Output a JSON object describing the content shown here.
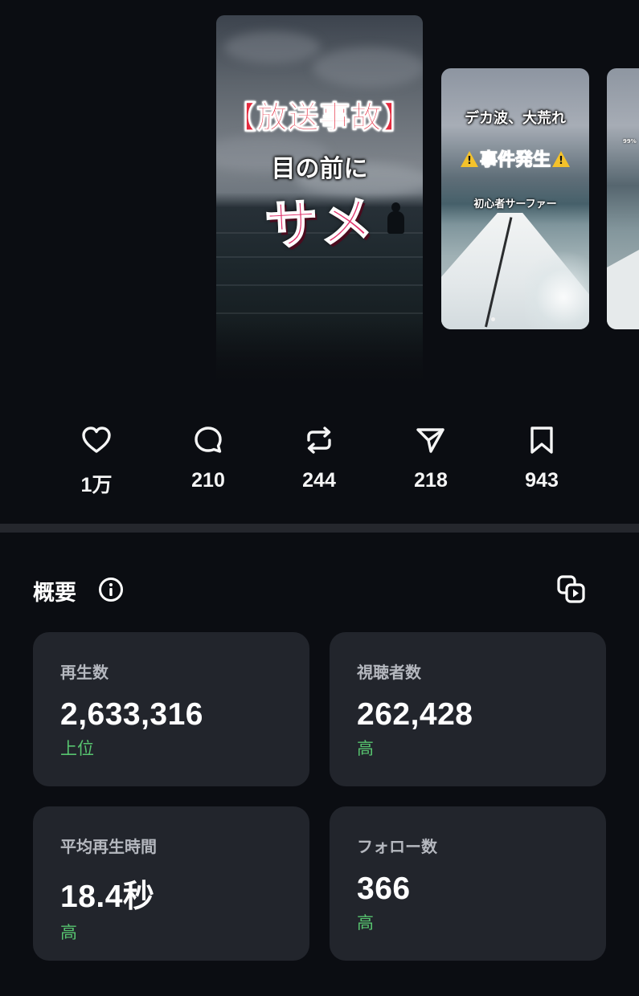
{
  "carousel": {
    "main": {
      "title_line1": "【放送事故】",
      "title_line2": "目の前に",
      "title_line3": "サメ"
    },
    "second": {
      "title_line1": "デカ波、大荒れ",
      "title_line2": "事件発生",
      "title_line3": "初心者サーファー"
    },
    "third": {
      "label": "99%"
    }
  },
  "actions": [
    {
      "icon": "heart-icon",
      "count": "1万"
    },
    {
      "icon": "comment-icon",
      "count": "210"
    },
    {
      "icon": "repost-icon",
      "count": "244"
    },
    {
      "icon": "send-icon",
      "count": "218"
    },
    {
      "icon": "bookmark-icon",
      "count": "943"
    }
  ],
  "overview": {
    "title": "概要",
    "info_icon": "info-icon",
    "copy_icon": "copy-icon",
    "cards": [
      {
        "label": "再生数",
        "value": "2,633,316",
        "rank": "上位"
      },
      {
        "label": "視聴者数",
        "value": "262,428",
        "rank": "高"
      },
      {
        "label": "平均再生時間",
        "value": "18.4秒",
        "rank": "高"
      },
      {
        "label": "フォロー数",
        "value": "366",
        "rank": "高"
      }
    ]
  },
  "colors": {
    "background": "#0b0d12",
    "card": "#22252c",
    "accent_green": "#57c46f",
    "divider": "#25272d"
  }
}
